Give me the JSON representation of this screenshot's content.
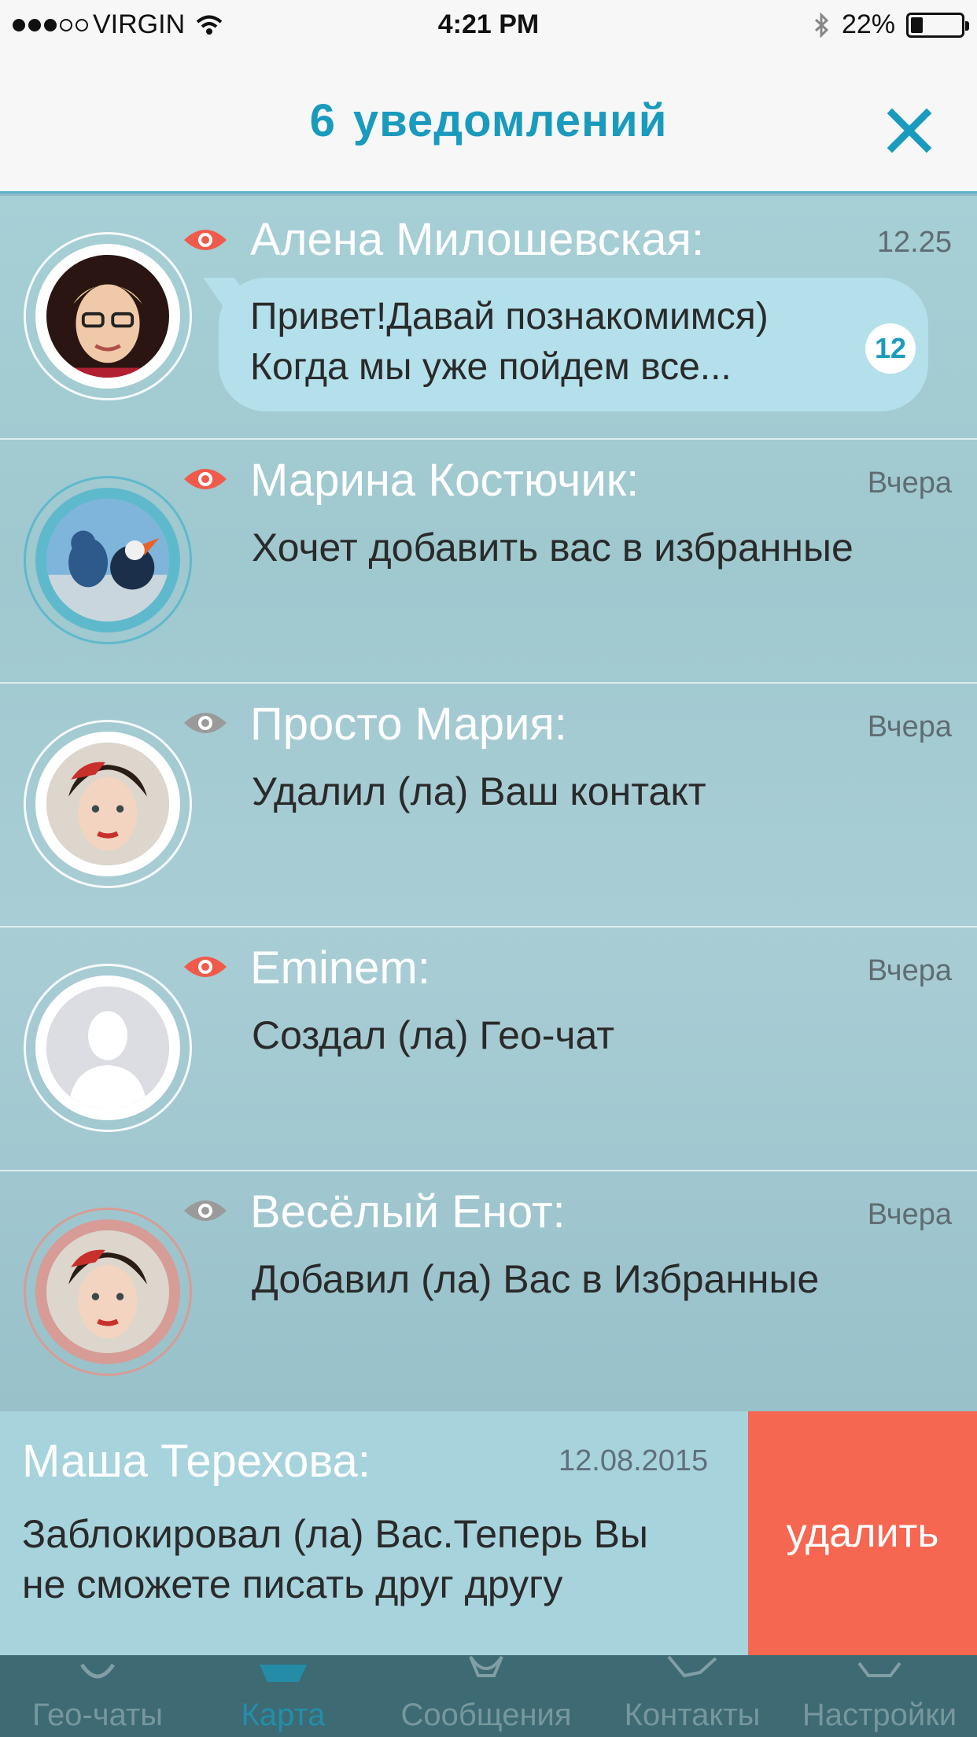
{
  "status_bar": {
    "carrier": "VIRGIN",
    "time": "4:21 PM",
    "battery": "22%",
    "battery_level": 0.22
  },
  "header": {
    "count": "6",
    "title": "уведомлений",
    "close_icon": "close-icon",
    "accent_color": "#1a9bbd"
  },
  "notifications": [
    {
      "name": "Алена Милошевская:",
      "time": "12.25",
      "message_line1": "Привет!Давай познакомимся)",
      "message_line2": "Когда мы уже пойдем все...",
      "unread_count": "12",
      "eye_state": "unseen",
      "eye_color": "#f05a4a"
    },
    {
      "name": "Марина Костючик:",
      "time": "Вчера",
      "message": "Хочет добавить вас в избранные",
      "eye_state": "unseen",
      "eye_color": "#f05a4a"
    },
    {
      "name": "Просто Мария:",
      "time": "Вчера",
      "message": "Удалил (ла) Ваш контакт",
      "eye_state": "seen",
      "eye_color": "#9a9a9a"
    },
    {
      "name": "Eminem:",
      "time": "Вчера",
      "message": "Создал (ла) Гео-чат",
      "eye_state": "unseen",
      "eye_color": "#f05a4a"
    },
    {
      "name": "Весёлый Енот:",
      "time": "Вчера",
      "message": "Добавил (ла) Вас в Избранные",
      "eye_state": "seen",
      "eye_color": "#9a9a9a"
    }
  ],
  "swiped_notification": {
    "name": "Маша Терехова:",
    "time": "12.08.2015",
    "message_line1": "Заблокировал (ла) Вас.Теперь Вы",
    "message_line2": "не сможете писать друг другу",
    "delete_label": "удалить",
    "delete_color": "#f56751"
  },
  "tabbar": {
    "tabs": [
      {
        "label": "Гео-чаты",
        "icon": "geo-chat-icon"
      },
      {
        "label": "Карта",
        "icon": "map-icon",
        "active": true
      },
      {
        "label": "Сообщения",
        "icon": "messages-icon"
      },
      {
        "label": "Контакты",
        "icon": "contacts-icon"
      },
      {
        "label": "Настройки",
        "icon": "settings-icon"
      }
    ]
  }
}
